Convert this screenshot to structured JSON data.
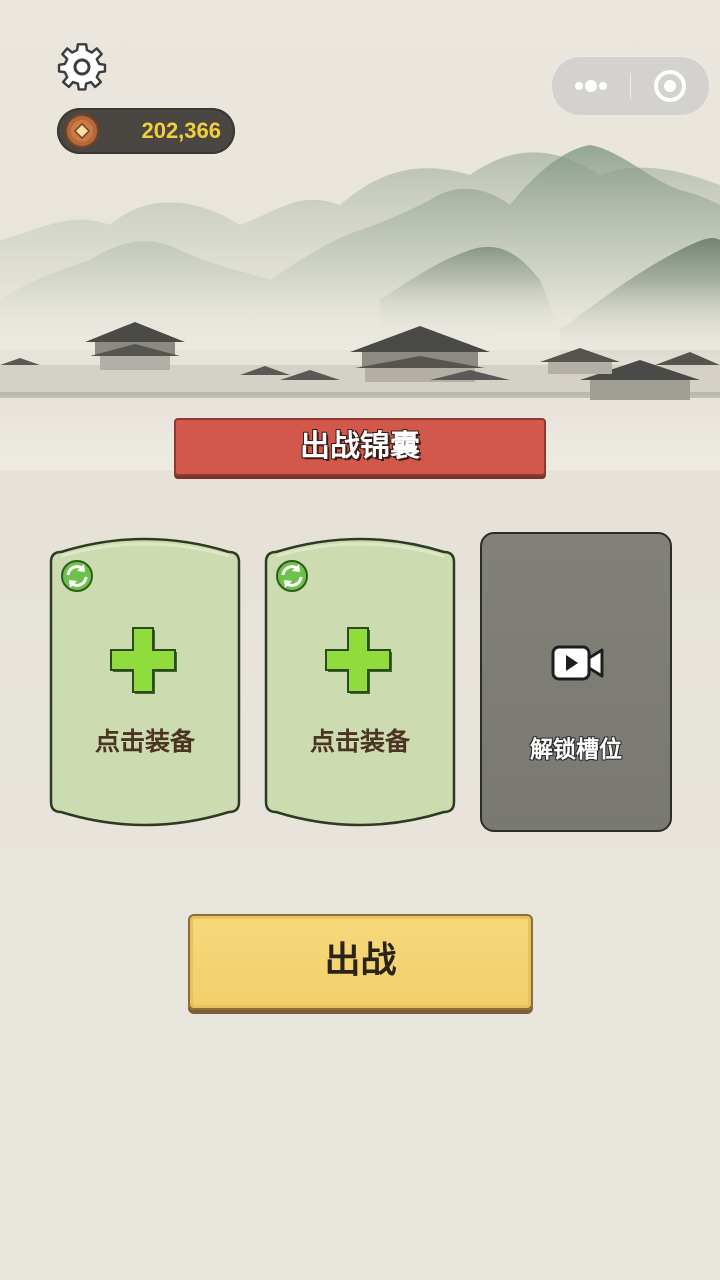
{
  "top_bar": {
    "settings_icon": "gear-icon",
    "coin_icon": "ancient-coin-icon",
    "coins": "202,366",
    "capsule": {
      "menu_icon": "more-dots-icon",
      "close_icon": "target-close-icon"
    }
  },
  "banner": {
    "title": "出战锦囊"
  },
  "slots": [
    {
      "label": "点击装备",
      "refresh_icon": "refresh-icon",
      "plus_icon": "plus-icon",
      "state": "empty"
    },
    {
      "label": "点击装备",
      "refresh_icon": "refresh-icon",
      "plus_icon": "plus-icon",
      "state": "empty"
    }
  ],
  "locked_slot": {
    "label": "解锁槽位",
    "icon": "video-camera-icon",
    "state": "locked"
  },
  "battle_button": {
    "label": "出战"
  },
  "colors": {
    "banner_red": "#d3584c",
    "slot_green": "#cddbb0",
    "plus_green": "#8fdc3c",
    "locked_gray": "#7f7e76",
    "button_yellow": "#f3d36f",
    "coin_text": "#f1cf3d"
  }
}
